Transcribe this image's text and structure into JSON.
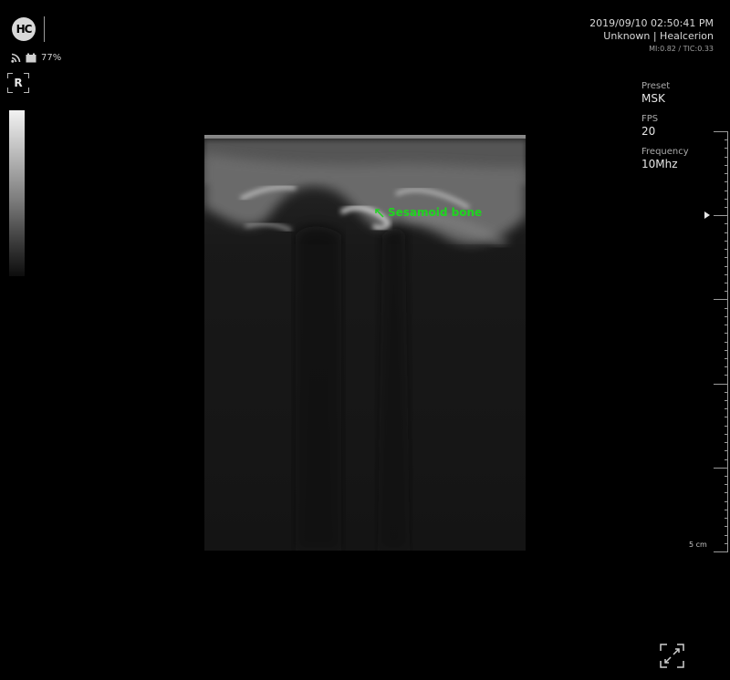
{
  "header": {
    "logo_text": "HC",
    "battery_percent": "77%",
    "orientation_marker": "R"
  },
  "info": {
    "datetime": "2019/09/10 02:50:41 PM",
    "patient": "Unknown | Healcerion",
    "indices": "MI:0.82 / TIC:0.33"
  },
  "params": [
    {
      "label": "Preset",
      "value": "MSK"
    },
    {
      "label": "FPS",
      "value": "20"
    },
    {
      "label": "Frequency",
      "value": "10Mhz"
    }
  ],
  "annotation": {
    "text": "Sesamoid bone",
    "color": "#1fd51f"
  },
  "ruler": {
    "depth_label": "5 cm"
  },
  "icons": [
    "wifi-icon",
    "battery-icon",
    "fullscreen-icon"
  ],
  "colors": {
    "background": "#000000",
    "annotation": "#1fd51f"
  }
}
